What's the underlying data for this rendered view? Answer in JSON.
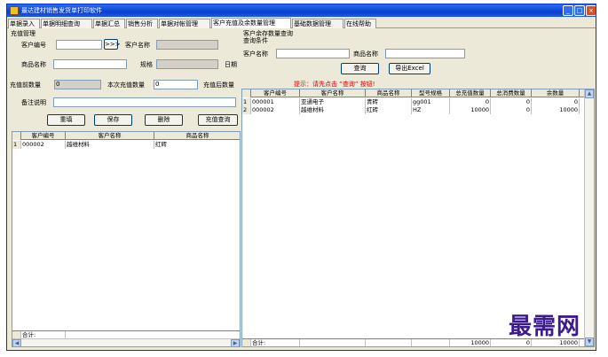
{
  "window": {
    "title": "最达建材销售发货单打印软件",
    "min": "_",
    "max": "□",
    "close": "×"
  },
  "tabs": [
    "单据录入",
    "单据明细查询",
    "单据汇总",
    "销售分析",
    "单据对帐管理",
    "客户充值及余数量管理",
    "基础数据管理",
    "在线帮助"
  ],
  "left": {
    "group_title": "充值管理",
    "customer_no_label": "客户编号",
    "customer_no_value": "",
    "lookup_btn": ">>>",
    "customer_name_label": "客户名称",
    "customer_name_value": "",
    "product_name_label": "商品名称",
    "product_name_value": "",
    "spec_label": "规格",
    "spec_value": "",
    "date_label": "日期",
    "before_qty_label": "充值前数量",
    "before_qty_value": "0",
    "this_qty_label": "本次充值数量",
    "this_qty_value": "0",
    "after_qty_label": "充值后数量",
    "note_label": "备注说明",
    "note_value": "",
    "buttons": {
      "reset": "重填",
      "save": "保存",
      "delete": "删除",
      "query": "充值查询"
    },
    "grid": {
      "headers": [
        "客户编号",
        "客户名称",
        "商品名称"
      ],
      "rows": [
        {
          "no": "1",
          "cells": [
            "000002",
            "越维材料",
            "红砖"
          ]
        }
      ],
      "footer_label": "合计:"
    }
  },
  "right": {
    "group_title": "客户余存数量查询",
    "subgroup_title": "查询条件",
    "customer_name_label": "客户名称",
    "customer_name_value": "",
    "product_name_label": "商品名称",
    "product_name_value": "",
    "query_btn": "查询",
    "export_btn": "导出Excel",
    "hint": "提示：请先点击 “查询” 按钮!",
    "grid": {
      "headers": [
        "客户编号",
        "客户名称",
        "商品名称",
        "型号规格",
        "总充值数量",
        "总消费数量",
        "余数量"
      ],
      "rows": [
        {
          "no": "1",
          "cells": [
            "000001",
            "亚通电子",
            "青砖",
            "gg001",
            "0",
            "0",
            "0"
          ]
        },
        {
          "no": "2",
          "cells": [
            "000002",
            "越维材料",
            "红砖",
            "HZ",
            "10000",
            "0",
            "10000"
          ]
        }
      ],
      "footer_label": "合计:",
      "footer_values": [
        "10000",
        "0",
        "10000"
      ]
    }
  },
  "watermark": "最需网",
  "colors": {
    "titlebar": "#0a3fd0",
    "hint": "#e00000",
    "window_bg": "#ece9d8"
  }
}
